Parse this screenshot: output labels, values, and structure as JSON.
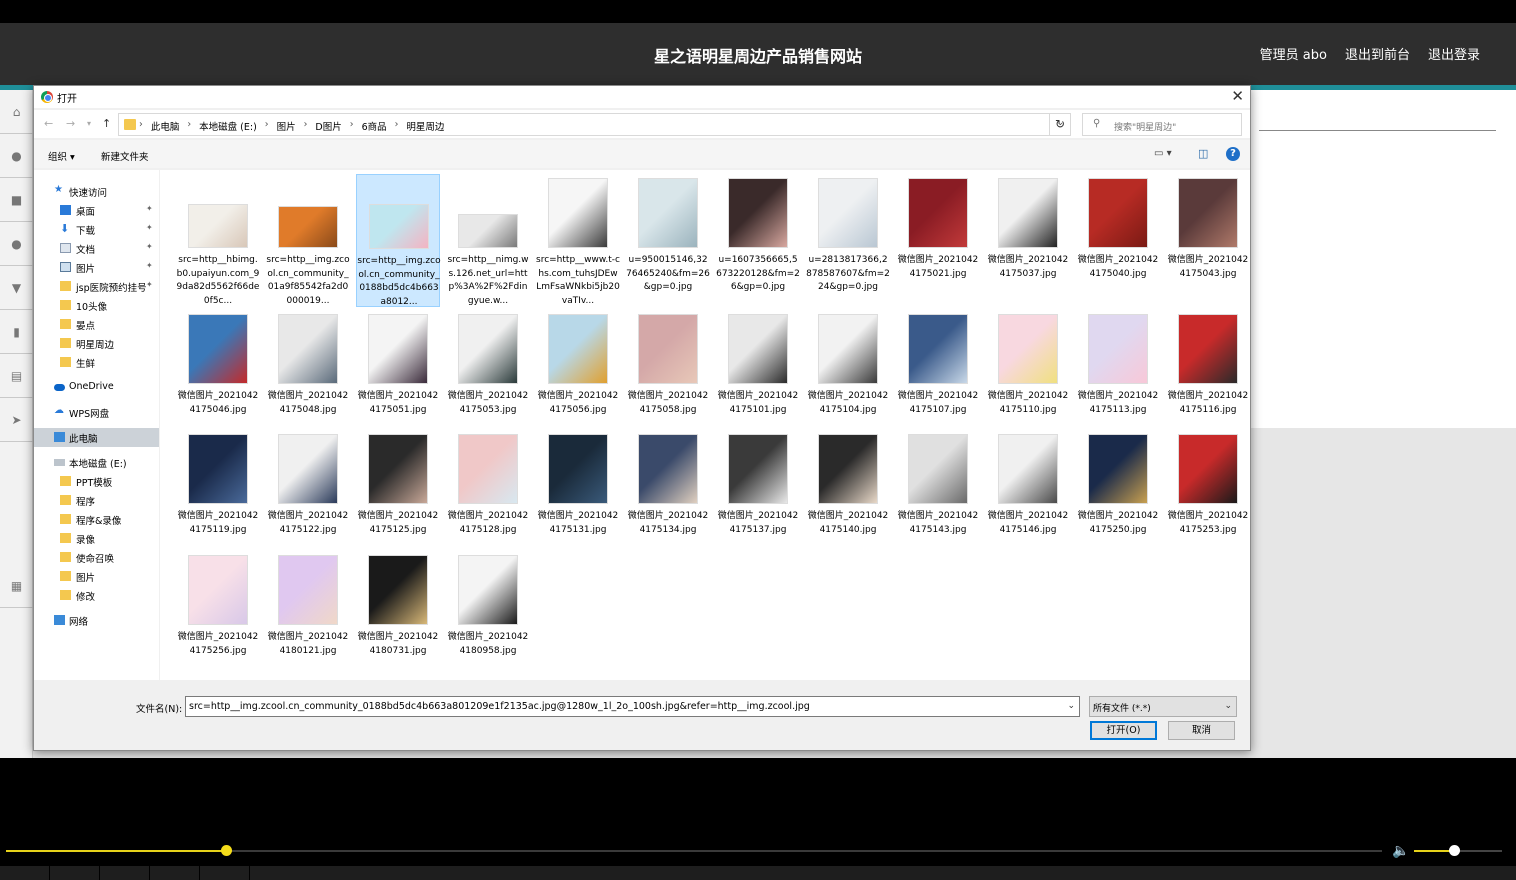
{
  "site": {
    "title": "星之语明星周边产品销售网站",
    "nav": [
      "管理员 abo",
      "退出到前台",
      "退出登录"
    ]
  },
  "dialog": {
    "title": "打开",
    "breadcrumbs": [
      "此电脑",
      "本地磁盘 (E:)",
      "图片",
      "D图片",
      "6商品",
      "明星周边"
    ],
    "search_placeholder": "搜索\"明星周边\"",
    "organize": "组织 ▾",
    "new_folder": "新建文件夹",
    "nav": {
      "quick_access": "快速访问",
      "pinned": [
        "桌面",
        "下载",
        "文档",
        "图片",
        "jsp医院预约挂号"
      ],
      "folders": [
        "10头像",
        "晏点",
        "明星周边",
        "生鲜"
      ],
      "onedrive": "OneDrive",
      "wps": "WPS网盘",
      "this_pc": "此电脑",
      "drive": "本地磁盘 (E:)",
      "drive_folders": [
        "PPT模板",
        "程序",
        "程序&录像",
        "录像",
        "使命召唤",
        "图片",
        "修改"
      ],
      "network": "网络"
    },
    "files": [
      {
        "name": "src=http__hbimg.b0.upaiyun.com_99da82d5562f66de0f5c...",
        "colors": [
          "#f2efe9",
          "#d8c7b8"
        ]
      },
      {
        "name": "src=http__img.zcool.cn_community_01a9f85542fa2d0000019...",
        "colors": [
          "#e07b2a",
          "#8a4a1a"
        ]
      },
      {
        "name": "src=http__img.zcool.cn_community_0188bd5dc4b663a8012...",
        "colors": [
          "#bfe6ef",
          "#f4b3c2"
        ]
      },
      {
        "name": "src=http__nimg.ws.126.net_url=http%3A%2F%2Fdingyue.w...",
        "colors": [
          "#e8e8e8",
          "#7a7a7a"
        ]
      },
      {
        "name": "src=http__www.t-chs.com_tuhsJDEwLmFsaWNkbi5jb20vaTIv...",
        "colors": [
          "#f6f6f6",
          "#3b3b3b"
        ]
      },
      {
        "name": "u=950015146,3276465240&fm=26&gp=0.jpg",
        "colors": [
          "#d9e6ea",
          "#9bb3bd"
        ]
      },
      {
        "name": "u=1607356665,5673220128&fm=26&gp=0.jpg",
        "colors": [
          "#3a2a2a",
          "#d8a8a0"
        ]
      },
      {
        "name": "u=2813817366,2878587607&fm=224&gp=0.jpg",
        "colors": [
          "#eef0f2",
          "#b9c7d3"
        ]
      },
      {
        "name": "微信图片_20210424175021.jpg",
        "colors": [
          "#8a1c24",
          "#c23a3a"
        ]
      },
      {
        "name": "微信图片_20210424175037.jpg",
        "colors": [
          "#f0f0f0",
          "#222222"
        ]
      },
      {
        "name": "微信图片_20210424175040.jpg",
        "colors": [
          "#b72b24",
          "#7a1a14"
        ]
      },
      {
        "name": "微信图片_20210424175043.jpg",
        "colors": [
          "#5a3a3a",
          "#b07a6a"
        ]
      },
      {
        "name": "微信图片_20210424175046.jpg",
        "colors": [
          "#3a78b8",
          "#c42a2a"
        ]
      },
      {
        "name": "微信图片_20210424175048.jpg",
        "colors": [
          "#e8e8e8",
          "#5a6a7a"
        ]
      },
      {
        "name": "微信图片_20210424175051.jpg",
        "colors": [
          "#f4f4f4",
          "#3a2a3a"
        ]
      },
      {
        "name": "微信图片_20210424175053.jpg",
        "colors": [
          "#f0f0f0",
          "#2a3a3a"
        ]
      },
      {
        "name": "微信图片_20210424175056.jpg",
        "colors": [
          "#b8d8e8",
          "#e0a030"
        ]
      },
      {
        "name": "微信图片_20210424175058.jpg",
        "colors": [
          "#d4a8a8",
          "#e8c8b8"
        ]
      },
      {
        "name": "微信图片_20210424175101.jpg",
        "colors": [
          "#e8e8e8",
          "#2a2a2a"
        ]
      },
      {
        "name": "微信图片_20210424175104.jpg",
        "colors": [
          "#f2f2f2",
          "#3a3a3a"
        ]
      },
      {
        "name": "微信图片_20210424175107.jpg",
        "colors": [
          "#3a5a8a",
          "#c8d8e8"
        ]
      },
      {
        "name": "微信图片_20210424175110.jpg",
        "colors": [
          "#f8d8e0",
          "#f0e080"
        ]
      },
      {
        "name": "微信图片_20210424175113.jpg",
        "colors": [
          "#e0d8f0",
          "#f8c8d8"
        ]
      },
      {
        "name": "微信图片_20210424175116.jpg",
        "colors": [
          "#c82a2a",
          "#2a2a2a"
        ]
      },
      {
        "name": "微信图片_20210424175119.jpg",
        "colors": [
          "#1a2a4a",
          "#4a6a9a"
        ]
      },
      {
        "name": "微信图片_20210424175122.jpg",
        "colors": [
          "#f0f0f0",
          "#2a3a5a"
        ]
      },
      {
        "name": "微信图片_20210424175125.jpg",
        "colors": [
          "#2a2a2a",
          "#c8a898"
        ]
      },
      {
        "name": "微信图片_20210424175128.jpg",
        "colors": [
          "#f0c8c8",
          "#d8e8f0"
        ]
      },
      {
        "name": "微信图片_20210424175131.jpg",
        "colors": [
          "#1a2a3a",
          "#3a5a7a"
        ]
      },
      {
        "name": "微信图片_20210424175134.jpg",
        "colors": [
          "#3a4a6a",
          "#e0d0c0"
        ]
      },
      {
        "name": "微信图片_20210424175137.jpg",
        "colors": [
          "#3a3a3a",
          "#e8e8e8"
        ]
      },
      {
        "name": "微信图片_20210424175140.jpg",
        "colors": [
          "#2a2a2a",
          "#e8d8c8"
        ]
      },
      {
        "name": "微信图片_20210424175143.jpg",
        "colors": [
          "#e0e0e0",
          "#6a6a6a"
        ]
      },
      {
        "name": "微信图片_20210424175146.jpg",
        "colors": [
          "#f0f0f0",
          "#4a4a4a"
        ]
      },
      {
        "name": "微信图片_20210424175250.jpg",
        "colors": [
          "#1a2a4a",
          "#c8a050"
        ]
      },
      {
        "name": "微信图片_20210424175253.jpg",
        "colors": [
          "#c82a2a",
          "#1a1a1a"
        ]
      },
      {
        "name": "微信图片_20210424175256.jpg",
        "colors": [
          "#f8e0e8",
          "#d8c8e8"
        ]
      },
      {
        "name": "微信图片_20210424180121.jpg",
        "colors": [
          "#e0c8f0",
          "#f0d8c8"
        ]
      },
      {
        "name": "微信图片_20210424180731.jpg",
        "colors": [
          "#1a1a1a",
          "#d8b878"
        ]
      },
      {
        "name": "微信图片_20210424180958.jpg",
        "colors": [
          "#f4f4f4",
          "#1a1a1a"
        ]
      }
    ],
    "selected_index": 2,
    "filename_label": "文件名(N):",
    "filename_value": "src=http__img.zcool.cn_community_0188bd5dc4b663a801209e1f2135ac.jpg@1280w_1l_2o_100sh.jpg&refer=http__img.zcool.jpg",
    "filter": "所有文件 (*.*)",
    "open_button": "打开(O)",
    "cancel_button": "取消"
  },
  "player": {
    "progress": 0.16,
    "volume": 0.45
  }
}
